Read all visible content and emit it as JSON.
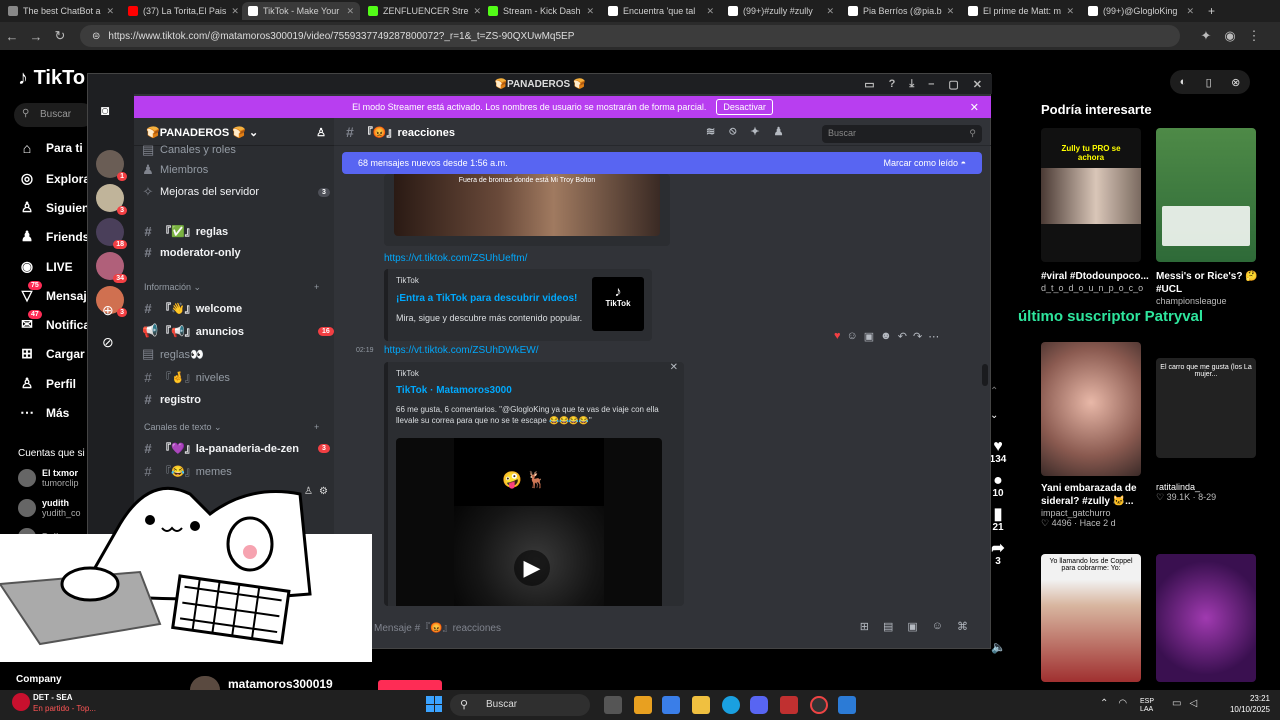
{
  "browser": {
    "tabs": [
      {
        "label": "The best ChatBot a",
        "color": "#888888"
      },
      {
        "label": "(37) La Torita,El Pais",
        "color": "#ff0000"
      },
      {
        "label": "TikTok - Make Your",
        "color": "#ffffff",
        "active": true
      },
      {
        "label": "ZENFLUENCER Stre",
        "color": "#53fc18"
      },
      {
        "label": "Stream - Kick Dash",
        "color": "#53fc18"
      },
      {
        "label": "Encuentra 'que tal",
        "color": "#ffffff"
      },
      {
        "label": "(99+)#zully #zully",
        "color": "#ffffff"
      },
      {
        "label": "Pia Berríos (@pia.b",
        "color": "#ffffff"
      },
      {
        "label": "El prime de Matt: m",
        "color": "#ffffff"
      },
      {
        "label": "(99+)@GlogloKing",
        "color": "#ffffff"
      }
    ],
    "url": "https://www.tiktok.com/@matamoros300019/video/7559337749287800072?_r=1&_t=ZS-90QXUwMq5EP"
  },
  "tiktok": {
    "logo": "TikTo",
    "search_placeholder": "Buscar",
    "nav": [
      {
        "label": "Para ti",
        "icon": "home-icon",
        "glyph": "⌂"
      },
      {
        "label": "Explora",
        "icon": "compass-icon",
        "glyph": "◎"
      },
      {
        "label": "Siguien",
        "icon": "following-icon",
        "glyph": "♙"
      },
      {
        "label": "Friends",
        "icon": "friends-icon",
        "glyph": "♟"
      },
      {
        "label": "LIVE",
        "icon": "live-icon",
        "glyph": "◉"
      },
      {
        "label": "Mensaje",
        "icon": "message-icon",
        "glyph": "▽",
        "badge": "75"
      },
      {
        "label": "Notifica",
        "icon": "inbox-icon",
        "glyph": "✉",
        "badge": "47"
      },
      {
        "label": "Cargar",
        "icon": "upload-icon",
        "glyph": "⊞"
      },
      {
        "label": "Perfil",
        "icon": "profile-icon",
        "glyph": "♙"
      },
      {
        "label": "Más",
        "icon": "more-icon",
        "glyph": "⋯"
      }
    ],
    "following_title": "Cuentas que si",
    "following": [
      {
        "name": "El txmor",
        "sub": "tumorclip"
      },
      {
        "name": "yudith",
        "sub": "yudith_co"
      },
      {
        "name": "Bella",
        "sub": ""
      }
    ],
    "company": "Company",
    "creator_handle": "matamoros300019",
    "actions": {
      "likes": "134",
      "comments": "10",
      "saves": "21",
      "shares": "3"
    },
    "recommend_title": "Podría interesarte",
    "recommendations": [
      {
        "overlay": "Zully tu PRO se achora",
        "title": "#viral #Dtodounpoco...",
        "author": "d_t_o_d_o_u_n_p_o_c_o",
        "stats": ""
      },
      {
        "overlay": "",
        "title": "Messi's or Rice's? 🤔 #UCL",
        "author": "championsleague",
        "stats": ""
      },
      {
        "overlay": "",
        "title": "Yani embarazada de sideral? #zully 🐱...",
        "author": "impact_gatchurro",
        "stats": "4496 · Hace 2 d"
      },
      {
        "overlay": "El carro que me gusta (los La mujer...",
        "title": "ratitalinda_",
        "author": "",
        "stats": "39.1K · 8-29"
      },
      {
        "overlay": "Yo llamando los de Coppel para cobrarme: Yo:",
        "title": "",
        "author": "",
        "stats": ""
      },
      {
        "overlay": "",
        "title": "",
        "author": "",
        "stats": ""
      }
    ],
    "stream_overlay": "último suscriptor Patryval"
  },
  "discord": {
    "window_title": "🍞PANADEROS 🍞",
    "streamer_notice": "El modo Streamer está activado. Los nombres de usuario se mostrarán de forma parcial.",
    "streamer_button": "Desactivar",
    "server_name": "🍞PANADEROS 🍞",
    "servers": [
      {
        "color": "#6a5d55",
        "badge": "1"
      },
      {
        "color": "#c0b49a",
        "badge": "3"
      },
      {
        "color": "#4a3f5a",
        "badge": "18"
      },
      {
        "color": "#b0607a",
        "badge": "34"
      },
      {
        "color": "#d07050",
        "badge": "3"
      }
    ],
    "channels_top": [
      {
        "label": "Canales y roles",
        "icon": "list-icon"
      },
      {
        "label": "Miembros",
        "icon": "members-icon"
      },
      {
        "label": "Mejoras del servidor",
        "icon": "boost-icon",
        "count": "3"
      }
    ],
    "channels_a": [
      {
        "label": "『✅』reglas",
        "unread": true
      },
      {
        "label": "moderator-only",
        "unread": true
      }
    ],
    "category_info": "Información",
    "channels_b": [
      {
        "label": "『👋』welcome",
        "unread": true,
        "icon": "#"
      },
      {
        "label": "『📢』anuncios",
        "unread": true,
        "count": "16",
        "icon": "📢"
      },
      {
        "label": "reglas👀",
        "unread": false,
        "icon": "▤"
      },
      {
        "label": "『🤞』niveles",
        "unread": false,
        "icon": "#"
      },
      {
        "label": "registro",
        "unread": true,
        "icon": "#"
      }
    ],
    "category_text": "Canales de texto",
    "channels_c": [
      {
        "label": "『💜』la-panaderia-de-zen",
        "unread": true,
        "count": "3"
      },
      {
        "label": "『😂』memes",
        "unread": false
      }
    ],
    "channel_title": "『😡』reacciones",
    "search_placeholder": "Buscar",
    "new_messages": "68 mensajes nuevos desde 1:56 a.m.",
    "mark_read": "Marcar como leído",
    "top_embed_caption": "Fuera de bromas donde está Mi Troy Bolton",
    "link1": "https://vt.tiktok.com/ZSUhUeftm/",
    "embed1": {
      "provider": "TikTok",
      "title": "¡Entra a TikTok para descubrir videos!",
      "desc": "Mira, sigue y descubre más contenido popular.",
      "logo_text": "TikTok"
    },
    "msg2_time": "02:19",
    "link2": "https://vt.tiktok.com/ZSUhDWkEW/",
    "embed2": {
      "provider": "TikTok",
      "title": "TikTok · Matamoros3000",
      "desc": "66 me gusta, 6 comentarios. \"@GlogloKing ya que te vas de viaje con ella llevale su correa para que no se te escape 😂😂😂😂\"",
      "video_emoji": "🤪 🦌"
    },
    "composer_placeholder": "Mensaje #『😡』reacciones"
  },
  "taskbar": {
    "weather_title": "DET - SEA",
    "weather_sub": "En partido - Top...",
    "search": "Buscar",
    "lang": "ESP\nLAA",
    "time": "23:21",
    "date": "10/10/2025"
  },
  "colors": {
    "discord_bg": "#313338",
    "streamer": "#b83ef0",
    "blurple": "#5865f2",
    "link": "#00a8fc",
    "tiktok_red": "#fe2c55"
  }
}
